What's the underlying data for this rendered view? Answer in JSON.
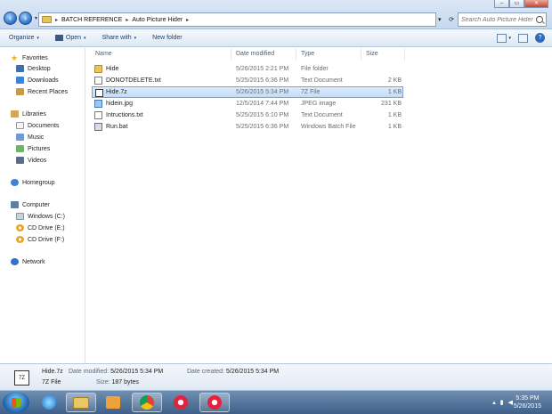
{
  "window": {
    "controls": [
      "–",
      "▭",
      "✕"
    ]
  },
  "address": {
    "crumbs": [
      "BATCH REFERENCE",
      "Auto Picture Hider"
    ]
  },
  "search": {
    "placeholder": "Search Auto Picture Hider"
  },
  "toolbar": {
    "organize": "Organize",
    "open": "Open",
    "share_with": "Share with",
    "new_folder": "New folder"
  },
  "nav": {
    "favorites": "Favorites",
    "desktop": "Desktop",
    "downloads": "Downloads",
    "recent": "Recent Places",
    "libraries": "Libraries",
    "documents": "Documents",
    "music": "Music",
    "pictures": "Pictures",
    "videos": "Videos",
    "homegroup": "Homegroup",
    "computer": "Computer",
    "drive_c": "Windows (C:)",
    "drive_e": "CD Drive (E:)",
    "drive_f": "CD Drive (F:)",
    "network": "Network"
  },
  "columns": {
    "name": "Name",
    "date": "Date modified",
    "type": "Type",
    "size": "Size"
  },
  "files": [
    {
      "name": "Hide",
      "date": "5/26/2015 2:21 PM",
      "type": "File folder",
      "size": "",
      "icon": "folder-icon"
    },
    {
      "name": "DONOTDELETE.txt",
      "date": "5/25/2015 6:36 PM",
      "type": "Text Document",
      "size": "2 KB",
      "icon": "text-file-icon"
    },
    {
      "name": "Hide.7z",
      "date": "5/26/2015 5:34 PM",
      "type": "7Z File",
      "size": "1 KB",
      "icon": "archive-icon"
    },
    {
      "name": "hidein.jpg",
      "date": "12/5/2014 7:44 PM",
      "type": "JPEG image",
      "size": "231 KB",
      "icon": "image-icon"
    },
    {
      "name": "Intructions.txt",
      "date": "5/25/2015 6:10 PM",
      "type": "Text Document",
      "size": "1 KB",
      "icon": "text-file-icon"
    },
    {
      "name": "Run.bat",
      "date": "5/25/2015 6:36 PM",
      "type": "Windows Batch File",
      "size": "1 KB",
      "icon": "batch-file-icon"
    }
  ],
  "details": {
    "name": "Hide.7z",
    "type": "7Z File",
    "date_modified_label": "Date modified:",
    "date_modified": "5/26/2015 5:34 PM",
    "date_created_label": "Date created:",
    "date_created": "5/26/2015 5:34 PM",
    "size_label": "Size:",
    "size": "187 bytes",
    "icon_text": "7Z"
  },
  "taskbar": {
    "time": "5:35 PM",
    "date": "5/26/2015"
  }
}
